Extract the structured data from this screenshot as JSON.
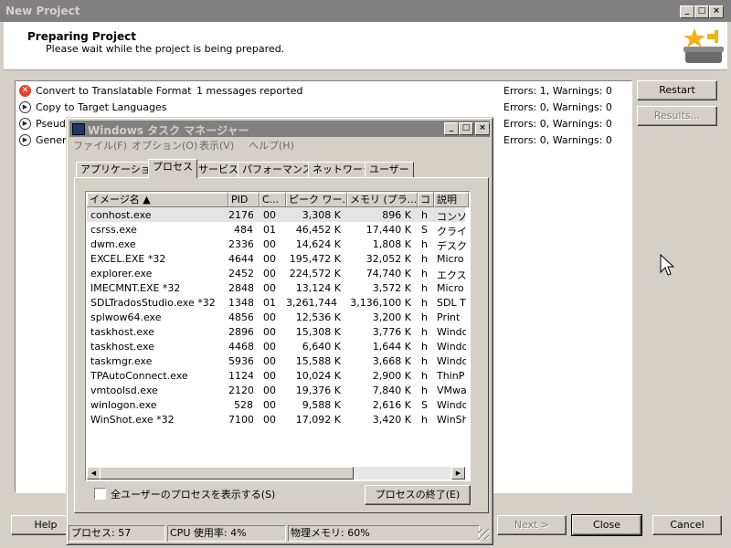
{
  "window": {
    "title": "New Project",
    "controls": [
      "_",
      "□",
      "×"
    ]
  },
  "header": {
    "title": "Preparing Project",
    "subtitle": "Please wait while the project is being prepared.",
    "icon": "project-wizard-icon"
  },
  "steps": [
    {
      "icon": "error-icon",
      "label": "Convert to Translatable Format",
      "message": "1 messages reported",
      "status": "Errors: 1, Warnings: 0"
    },
    {
      "icon": "play-icon",
      "label": "Copy to Target Languages",
      "message": "",
      "status": "Errors: 0, Warnings: 0"
    },
    {
      "icon": "play-icon",
      "label": "Pseudo",
      "message": "",
      "status": "Errors: 0, Warnings: 0"
    },
    {
      "icon": "play-icon",
      "label": "Genera",
      "message": "",
      "status": "Errors: 0, Warnings: 0"
    }
  ],
  "side_buttons": {
    "restart": "Restart",
    "results": "Results..."
  },
  "bottom_buttons": {
    "help": "Help",
    "next": "Next >",
    "close": "Close",
    "cancel": "Cancel"
  },
  "taskmgr": {
    "title": "Windows タスク マネージャー",
    "controls": [
      "_",
      "□",
      "×"
    ],
    "menu": [
      "ファイル(F)",
      "オプション(O)",
      "表示(V)",
      "ヘルプ(H)"
    ],
    "tabs": [
      "アプリケーション",
      "プロセス",
      "サービス",
      "パフォーマンス",
      "ネットワーク",
      "ユーザー"
    ],
    "active_tab": "プロセス",
    "columns": [
      "イメージ名 ▲",
      "PID",
      "C...",
      "ピーク ワー...",
      "メモリ (プラ...",
      "コ",
      "説明"
    ],
    "processes": [
      [
        "conhost.exe",
        "2176",
        "00",
        "3,308 K",
        "896 K",
        "h",
        "コンソ"
      ],
      [
        "csrss.exe",
        "484",
        "01",
        "46,452 K",
        "17,440 K",
        "S",
        "クライ"
      ],
      [
        "dwm.exe",
        "2336",
        "00",
        "14,624 K",
        "1,808 K",
        "h",
        "デスク"
      ],
      [
        "EXCEL.EXE *32",
        "4644",
        "00",
        "195,472 K",
        "32,052 K",
        "h",
        "Micro"
      ],
      [
        "explorer.exe",
        "2452",
        "00",
        "224,572 K",
        "74,740 K",
        "h",
        "エクス"
      ],
      [
        "IMECMNT.EXE *32",
        "2848",
        "00",
        "13,124 K",
        "3,572 K",
        "h",
        "Micro"
      ],
      [
        "SDLTradosStudio.exe *32",
        "1348",
        "01",
        "3,261,744 K",
        "3,136,100 K",
        "h",
        "SDL T"
      ],
      [
        "splwow64.exe",
        "4856",
        "00",
        "12,536 K",
        "3,200 K",
        "h",
        "Print"
      ],
      [
        "taskhost.exe",
        "2896",
        "00",
        "15,308 K",
        "3,776 K",
        "h",
        "Windo"
      ],
      [
        "taskhost.exe",
        "4468",
        "00",
        "6,640 K",
        "1,644 K",
        "h",
        "Windo"
      ],
      [
        "taskmgr.exe",
        "5936",
        "00",
        "15,588 K",
        "3,668 K",
        "h",
        "Windo"
      ],
      [
        "TPAutoConnect.exe",
        "1124",
        "00",
        "10,024 K",
        "2,900 K",
        "h",
        "ThinP"
      ],
      [
        "vmtoolsd.exe",
        "2120",
        "00",
        "19,376 K",
        "7,840 K",
        "h",
        "VMwa"
      ],
      [
        "winlogon.exe",
        "528",
        "00",
        "9,588 K",
        "2,616 K",
        "S",
        "Windo"
      ],
      [
        "WinShot.exe *32",
        "7100",
        "00",
        "17,092 K",
        "3,420 K",
        "h",
        "WinSh"
      ]
    ],
    "selected_row": 0,
    "show_all_label": "全ユーザーのプロセスを表示する(S)",
    "end_process_label": "プロセスの終了(E)",
    "status": {
      "processes": "プロセス: 57",
      "cpu": "CPU 使用率: 4%",
      "memory": "物理メモリ: 60%"
    }
  }
}
